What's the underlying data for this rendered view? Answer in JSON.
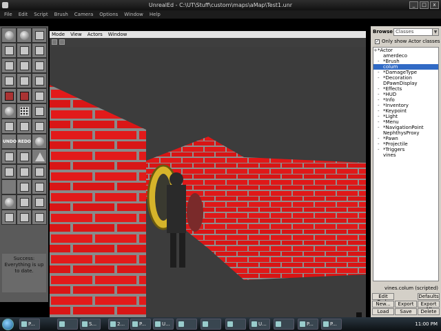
{
  "window": {
    "title": "UnrealEd - C:\\UT\\Stuff\\custom\\maps\\aMap\\Test1.unr",
    "buttons": [
      "_",
      "□",
      "x"
    ]
  },
  "menubar": [
    "File",
    "Edit",
    "Script",
    "Brush",
    "Camera",
    "Options",
    "Window",
    "Help"
  ],
  "toolbar": {
    "undo": "UNDO",
    "redo": "REDO",
    "status": "Success: Everything is up to date."
  },
  "viewport": {
    "menu": [
      "Mode",
      "View",
      "Actors",
      "Window"
    ]
  },
  "browser": {
    "title": "Browse",
    "type": "Classes",
    "only_actor_label": "Only show Actor classes",
    "only_actor_checked": true,
    "tree": [
      {
        "label": "*Actor",
        "exp": "+",
        "depth": 0
      },
      {
        "label": "amerdeco",
        "exp": "",
        "depth": 1
      },
      {
        "label": "*Brush",
        "exp": "-",
        "depth": 1
      },
      {
        "label": "colum",
        "exp": "",
        "depth": 1,
        "selected": true
      },
      {
        "label": "*DamageType",
        "exp": "-",
        "depth": 1
      },
      {
        "label": "*Decoration",
        "exp": "-",
        "depth": 1
      },
      {
        "label": "DPawnDisplay",
        "exp": "",
        "depth": 1
      },
      {
        "label": "*Effects",
        "exp": "-",
        "depth": 1
      },
      {
        "label": "*HUD",
        "exp": "-",
        "depth": 1
      },
      {
        "label": "*Info",
        "exp": "-",
        "depth": 1
      },
      {
        "label": "*Inventory",
        "exp": "-",
        "depth": 1
      },
      {
        "label": "*Keypoint",
        "exp": "-",
        "depth": 1
      },
      {
        "label": "*Light",
        "exp": "-",
        "depth": 1
      },
      {
        "label": "*Menu",
        "exp": "-",
        "depth": 1
      },
      {
        "label": "*NavigationPoint",
        "exp": "-",
        "depth": 1
      },
      {
        "label": "NephthysProxy",
        "exp": "",
        "depth": 1
      },
      {
        "label": "*Pawn",
        "exp": "-",
        "depth": 1
      },
      {
        "label": "*Projectile",
        "exp": "-",
        "depth": 1
      },
      {
        "label": "*Triggers",
        "exp": "-",
        "depth": 1
      },
      {
        "label": "vines",
        "exp": "",
        "depth": 1
      }
    ],
    "selection_info": "vines.colum (scripted)",
    "buttons": [
      "Edit Code",
      "",
      "Defaults",
      "New...",
      "Export",
      "Export All",
      "Load",
      "Save",
      "Delete"
    ]
  },
  "taskbar": {
    "tasks": [
      "P...",
      "",
      "S...",
      "2...",
      "P...",
      "U...",
      "",
      "",
      "",
      "U...",
      "",
      "P...",
      "P..."
    ],
    "clock": "11:00 PM"
  }
}
